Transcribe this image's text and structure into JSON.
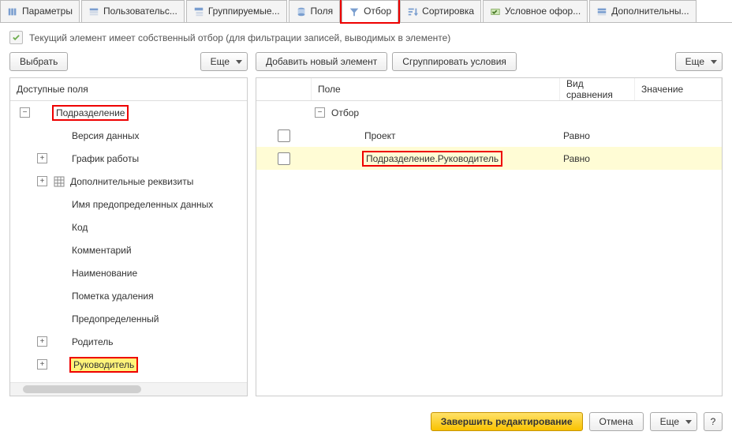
{
  "tabs": [
    {
      "label": "Параметры",
      "icon": "params"
    },
    {
      "label": "Пользовательс...",
      "icon": "userfields"
    },
    {
      "label": "Группируемые...",
      "icon": "group"
    },
    {
      "label": "Поля",
      "icon": "fields"
    },
    {
      "label": "Отбор",
      "icon": "filter",
      "active": true,
      "highlight": true
    },
    {
      "label": "Сортировка",
      "icon": "sort"
    },
    {
      "label": "Условное офор...",
      "icon": "cond"
    },
    {
      "label": "Дополнительны...",
      "icon": "extra"
    }
  ],
  "info_line": "Текущий элемент имеет собственный отбор (для фильтрации записей, выводимых в элементе)",
  "left": {
    "choose": "Выбрать",
    "more": "Еще",
    "header": "Доступные поля",
    "root": "Подразделение",
    "children": [
      {
        "label": "Версия данных",
        "exp": "none"
      },
      {
        "label": "График работы",
        "exp": "plus"
      },
      {
        "label": "Дополнительные реквизиты",
        "exp": "plus",
        "table": true
      },
      {
        "label": "Имя предопределенных данных",
        "exp": "none"
      },
      {
        "label": "Код",
        "exp": "none"
      },
      {
        "label": "Комментарий",
        "exp": "none"
      },
      {
        "label": "Наименование",
        "exp": "none"
      },
      {
        "label": "Пометка удаления",
        "exp": "none"
      },
      {
        "label": "Предопределенный",
        "exp": "none"
      },
      {
        "label": "Родитель",
        "exp": "plus"
      },
      {
        "label": "Руководитель",
        "exp": "plus",
        "highlight": "yellow"
      }
    ]
  },
  "right": {
    "add": "Добавить новый элемент",
    "group": "Сгруппировать условия",
    "more": "Еще",
    "cols": {
      "field": "Поле",
      "cmp": "Вид сравнения",
      "val": "Значение"
    },
    "root": "Отбор",
    "rows": [
      {
        "field": "Проект",
        "cmp": "Равно"
      },
      {
        "field": "Подразделение.Руководитель",
        "cmp": "Равно",
        "selected": true,
        "highlight": true
      }
    ]
  },
  "footer": {
    "finish": "Завершить редактирование",
    "cancel": "Отмена",
    "more": "Еще",
    "help": "?"
  }
}
